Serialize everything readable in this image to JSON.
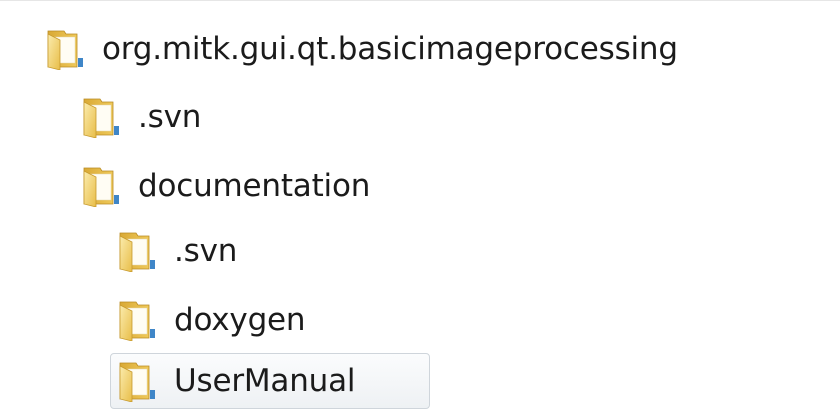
{
  "tree": {
    "items": [
      {
        "label": "org.mitk.gui.qt.basicimageprocessing",
        "icon": "folder-icon",
        "level": 0,
        "selected": false
      },
      {
        "label": ".svn",
        "icon": "folder-icon",
        "level": 1,
        "selected": false
      },
      {
        "label": "documentation",
        "icon": "folder-icon",
        "level": 1,
        "selected": false
      },
      {
        "label": ".svn",
        "icon": "folder-icon",
        "level": 2,
        "selected": false
      },
      {
        "label": "doxygen",
        "icon": "folder-icon",
        "level": 2,
        "selected": false
      },
      {
        "label": "UserManual",
        "icon": "folder-icon",
        "level": 2,
        "selected": true
      }
    ]
  },
  "colors": {
    "folder_body": "#e9c45a",
    "folder_front": "#f6dd8a",
    "selection_border": "#cfd5db",
    "text": "#1b1b1b"
  }
}
